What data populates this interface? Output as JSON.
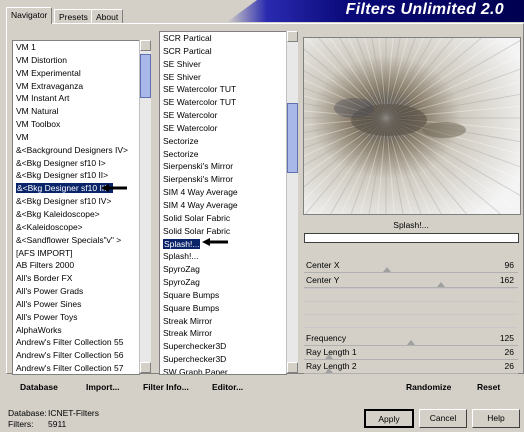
{
  "tabs": [
    "Navigator",
    "Presets",
    "About"
  ],
  "banner_title": "Filters Unlimited 2.0",
  "categories": [
    "VM 1",
    "VM Distortion",
    "VM Experimental",
    "VM Extravaganza",
    "VM Instant Art",
    "VM Natural",
    "VM Toolbox",
    "VM",
    "&<Background Designers IV>",
    "&<Bkg Designer sf10 I>",
    "&<Bkg Designer sf10 II>",
    "&<Bkg Designer sf10 III>",
    "&<Bkg Designer sf10 IV>",
    "&<Bkg Kaleidoscope>",
    "&<Kaleidoscope>",
    "&<Sandflower Specials\"v\" >",
    "[AFS IMPORT]",
    "AB Filters 2000",
    "All's Border FX",
    "All's Power Grads",
    "All's Power Sines",
    "All's Power Toys",
    "AlphaWorks",
    "Andrew's Filter Collection 55",
    "Andrew's Filter Collection 56",
    "Andrew's Filter Collection 57"
  ],
  "filters": [
    "SCR  Partical",
    "SCR  Partical",
    "SE Shiver",
    "SE Shiver",
    "SE Watercolor TUT",
    "SE Watercolor TUT",
    "SE Watercolor",
    "SE Watercolor",
    "Sectorize",
    "Sectorize",
    "Sierpenski's Mirror",
    "Sierpenski's Mirror",
    "SIM 4 Way Average",
    "SIM 4 Way Average",
    "Solid Solar Fabric",
    "Solid Solar Fabric",
    "Splash!...",
    "Splash!...",
    "SpyroZag",
    "SpyroZag",
    "Square Bumps",
    "Square Bumps",
    "Streak Mirror",
    "Streak Mirror",
    "Superchecker3D",
    "Superchecker3D",
    "SW Graph Paper"
  ],
  "selected_category_index": 11,
  "selected_filter_index": 16,
  "filter_name": "Splash!...",
  "params": [
    {
      "label": "Center X",
      "value": "96",
      "level": 0.376
    },
    {
      "label": "Center Y",
      "value": "162",
      "level": 0.635
    },
    {
      "label": "Frequency",
      "value": "125",
      "level": 0.49
    },
    {
      "label": "Ray Length 1",
      "value": "26",
      "level": 0.1
    },
    {
      "label": "Ray Length 2",
      "value": "26",
      "level": 0.1
    }
  ],
  "bottom_links": {
    "database": "Database",
    "import": "Import...",
    "filter_info": "Filter Info...",
    "editor": "Editor...",
    "randomize": "Randomize",
    "reset": "Reset"
  },
  "status": {
    "database_label": "Database:",
    "database_value": "ICNET-Filters",
    "filters_label": "Filters:",
    "filters_value": "5911"
  },
  "buttons": {
    "apply": "Apply",
    "cancel": "Cancel",
    "help": "Help"
  }
}
